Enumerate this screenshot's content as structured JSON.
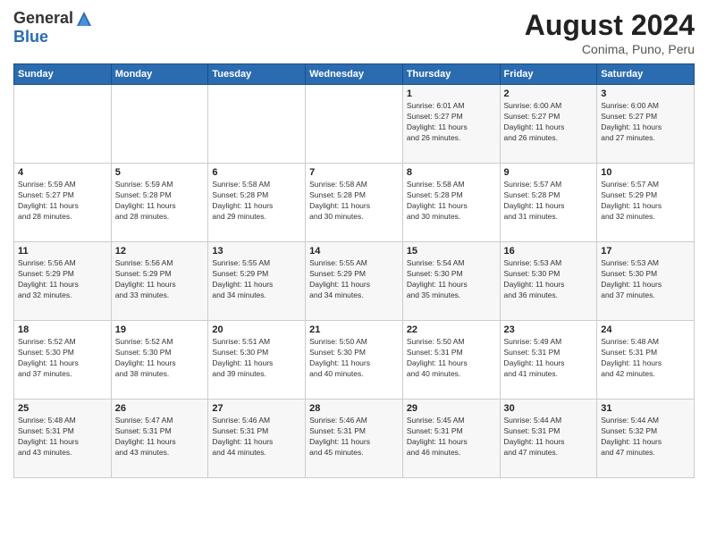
{
  "logo": {
    "general": "General",
    "blue": "Blue"
  },
  "title": {
    "month": "August 2024",
    "location": "Conima, Puno, Peru"
  },
  "headers": [
    "Sunday",
    "Monday",
    "Tuesday",
    "Wednesday",
    "Thursday",
    "Friday",
    "Saturday"
  ],
  "weeks": [
    [
      {
        "day": "",
        "info": ""
      },
      {
        "day": "",
        "info": ""
      },
      {
        "day": "",
        "info": ""
      },
      {
        "day": "",
        "info": ""
      },
      {
        "day": "1",
        "info": "Sunrise: 6:01 AM\nSunset: 5:27 PM\nDaylight: 11 hours\nand 26 minutes."
      },
      {
        "day": "2",
        "info": "Sunrise: 6:00 AM\nSunset: 5:27 PM\nDaylight: 11 hours\nand 26 minutes."
      },
      {
        "day": "3",
        "info": "Sunrise: 6:00 AM\nSunset: 5:27 PM\nDaylight: 11 hours\nand 27 minutes."
      }
    ],
    [
      {
        "day": "4",
        "info": "Sunrise: 5:59 AM\nSunset: 5:27 PM\nDaylight: 11 hours\nand 28 minutes."
      },
      {
        "day": "5",
        "info": "Sunrise: 5:59 AM\nSunset: 5:28 PM\nDaylight: 11 hours\nand 28 minutes."
      },
      {
        "day": "6",
        "info": "Sunrise: 5:58 AM\nSunset: 5:28 PM\nDaylight: 11 hours\nand 29 minutes."
      },
      {
        "day": "7",
        "info": "Sunrise: 5:58 AM\nSunset: 5:28 PM\nDaylight: 11 hours\nand 30 minutes."
      },
      {
        "day": "8",
        "info": "Sunrise: 5:58 AM\nSunset: 5:28 PM\nDaylight: 11 hours\nand 30 minutes."
      },
      {
        "day": "9",
        "info": "Sunrise: 5:57 AM\nSunset: 5:28 PM\nDaylight: 11 hours\nand 31 minutes."
      },
      {
        "day": "10",
        "info": "Sunrise: 5:57 AM\nSunset: 5:29 PM\nDaylight: 11 hours\nand 32 minutes."
      }
    ],
    [
      {
        "day": "11",
        "info": "Sunrise: 5:56 AM\nSunset: 5:29 PM\nDaylight: 11 hours\nand 32 minutes."
      },
      {
        "day": "12",
        "info": "Sunrise: 5:56 AM\nSunset: 5:29 PM\nDaylight: 11 hours\nand 33 minutes."
      },
      {
        "day": "13",
        "info": "Sunrise: 5:55 AM\nSunset: 5:29 PM\nDaylight: 11 hours\nand 34 minutes."
      },
      {
        "day": "14",
        "info": "Sunrise: 5:55 AM\nSunset: 5:29 PM\nDaylight: 11 hours\nand 34 minutes."
      },
      {
        "day": "15",
        "info": "Sunrise: 5:54 AM\nSunset: 5:30 PM\nDaylight: 11 hours\nand 35 minutes."
      },
      {
        "day": "16",
        "info": "Sunrise: 5:53 AM\nSunset: 5:30 PM\nDaylight: 11 hours\nand 36 minutes."
      },
      {
        "day": "17",
        "info": "Sunrise: 5:53 AM\nSunset: 5:30 PM\nDaylight: 11 hours\nand 37 minutes."
      }
    ],
    [
      {
        "day": "18",
        "info": "Sunrise: 5:52 AM\nSunset: 5:30 PM\nDaylight: 11 hours\nand 37 minutes."
      },
      {
        "day": "19",
        "info": "Sunrise: 5:52 AM\nSunset: 5:30 PM\nDaylight: 11 hours\nand 38 minutes."
      },
      {
        "day": "20",
        "info": "Sunrise: 5:51 AM\nSunset: 5:30 PM\nDaylight: 11 hours\nand 39 minutes."
      },
      {
        "day": "21",
        "info": "Sunrise: 5:50 AM\nSunset: 5:30 PM\nDaylight: 11 hours\nand 40 minutes."
      },
      {
        "day": "22",
        "info": "Sunrise: 5:50 AM\nSunset: 5:31 PM\nDaylight: 11 hours\nand 40 minutes."
      },
      {
        "day": "23",
        "info": "Sunrise: 5:49 AM\nSunset: 5:31 PM\nDaylight: 11 hours\nand 41 minutes."
      },
      {
        "day": "24",
        "info": "Sunrise: 5:48 AM\nSunset: 5:31 PM\nDaylight: 11 hours\nand 42 minutes."
      }
    ],
    [
      {
        "day": "25",
        "info": "Sunrise: 5:48 AM\nSunset: 5:31 PM\nDaylight: 11 hours\nand 43 minutes."
      },
      {
        "day": "26",
        "info": "Sunrise: 5:47 AM\nSunset: 5:31 PM\nDaylight: 11 hours\nand 43 minutes."
      },
      {
        "day": "27",
        "info": "Sunrise: 5:46 AM\nSunset: 5:31 PM\nDaylight: 11 hours\nand 44 minutes."
      },
      {
        "day": "28",
        "info": "Sunrise: 5:46 AM\nSunset: 5:31 PM\nDaylight: 11 hours\nand 45 minutes."
      },
      {
        "day": "29",
        "info": "Sunrise: 5:45 AM\nSunset: 5:31 PM\nDaylight: 11 hours\nand 46 minutes."
      },
      {
        "day": "30",
        "info": "Sunrise: 5:44 AM\nSunset: 5:31 PM\nDaylight: 11 hours\nand 47 minutes."
      },
      {
        "day": "31",
        "info": "Sunrise: 5:44 AM\nSunset: 5:32 PM\nDaylight: 11 hours\nand 47 minutes."
      }
    ]
  ]
}
